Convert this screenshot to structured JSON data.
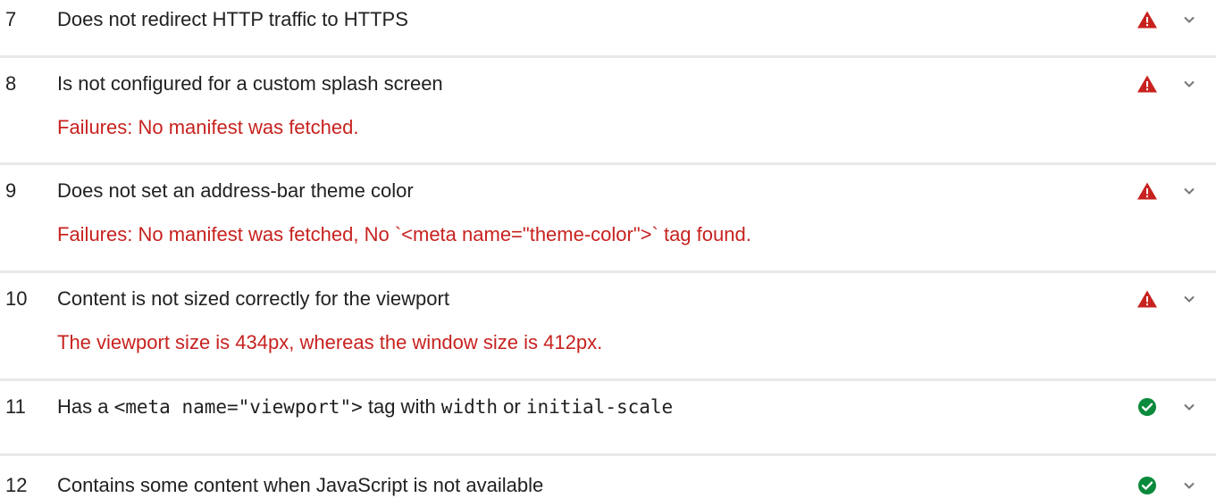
{
  "audits": [
    {
      "index": "7",
      "title": "Does not redirect HTTP traffic to HTTPS",
      "status": "fail",
      "status_icon": "warning-triangle-icon",
      "details": ""
    },
    {
      "index": "8",
      "title": "Is not configured for a custom splash screen",
      "status": "fail",
      "status_icon": "warning-triangle-icon",
      "details": "Failures: No manifest was fetched."
    },
    {
      "index": "9",
      "title": "Does not set an address-bar theme color",
      "status": "fail",
      "status_icon": "warning-triangle-icon",
      "details": "Failures: No manifest was fetched, No `<meta name=\"theme-color\">` tag found."
    },
    {
      "index": "10",
      "title": "Content is not sized correctly for the viewport",
      "status": "fail",
      "status_icon": "warning-triangle-icon",
      "details": "The viewport size is 434px, whereas the window size is 412px."
    },
    {
      "index": "11",
      "title_parts": {
        "t1": "Has a ",
        "c1": "<meta name=\"viewport\">",
        "t2": " tag with ",
        "c2": "width",
        "t3": " or ",
        "c3": "initial-scale"
      },
      "status": "pass",
      "status_icon": "check-circle-icon",
      "details": ""
    },
    {
      "index": "12",
      "title": "Contains some content when JavaScript is not available",
      "status": "pass",
      "status_icon": "check-circle-icon",
      "details": ""
    }
  ],
  "colors": {
    "fail": "#c7221f",
    "pass": "#0a8a3c",
    "chevron": "#757575",
    "divider": "#e8e8e8"
  },
  "icons": {
    "expand": "chevron-down-icon"
  }
}
